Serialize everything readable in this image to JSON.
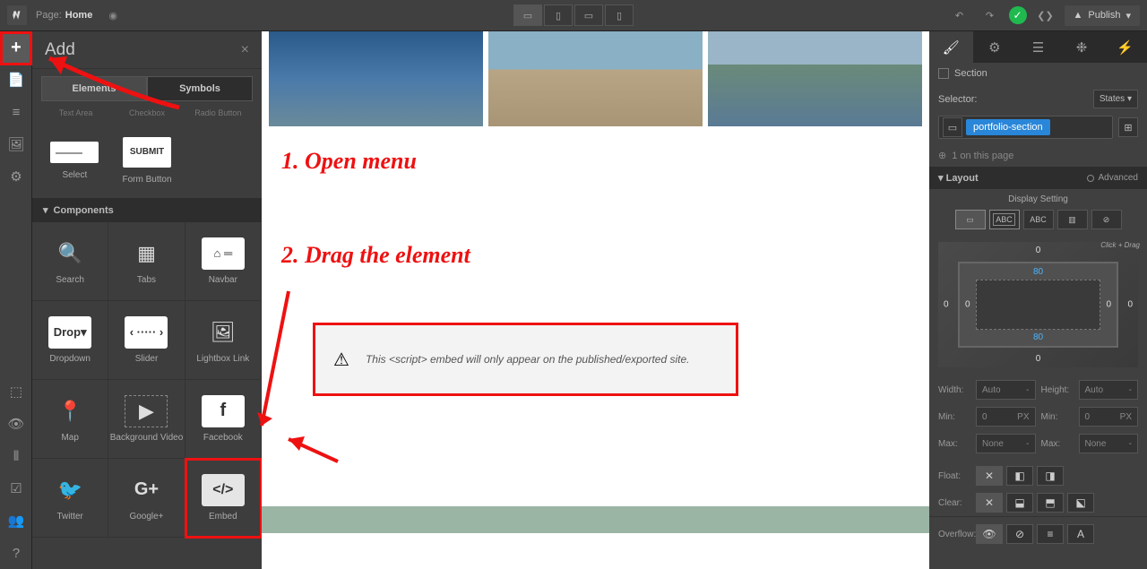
{
  "topbar": {
    "page_label": "Page:",
    "page_name": "Home",
    "publish": "Publish"
  },
  "add_panel": {
    "title": "Add",
    "tabs": {
      "elements": "Elements",
      "symbols": "Symbols"
    },
    "mini": {
      "textarea": "Text Area",
      "checkbox": "Checkbox",
      "radio": "Radio Button"
    },
    "form": {
      "select_label": "Select",
      "submit_text": "SUBMIT",
      "form_button_label": "Form Button"
    },
    "components_hdr": "Components",
    "components": {
      "search": "Search",
      "tabs": "Tabs",
      "navbar": "Navbar",
      "dropdown": "Dropdown",
      "drop_text": "Drop",
      "slider": "Slider",
      "lightbox": "Lightbox Link",
      "map": "Map",
      "bgvideo": "Background Video",
      "facebook": "Facebook",
      "twitter": "Twitter",
      "googleplus": "Google+",
      "embed": "Embed"
    }
  },
  "canvas": {
    "step1": "1. Open menu",
    "step2": "2. Drag the element",
    "embed_msg": "This <script> embed will only appear on the published/exported site."
  },
  "right_panel": {
    "section_label": "Section",
    "selector_label": "Selector:",
    "states": "States",
    "selector_value": "portfolio-section",
    "instances": "1 on this page",
    "layout_hdr": "Layout",
    "advanced": "Advanced",
    "display_setting": "Display Setting",
    "disp_abc": "ABC",
    "spacing": {
      "top": "0",
      "right": "0",
      "bottom": "0",
      "left": "0",
      "pad_top": "80",
      "pad_bottom": "80",
      "pad_left": "0",
      "pad_right": "0",
      "click_drag": "Click + Drag"
    },
    "width_label": "Width:",
    "height_label": "Height:",
    "auto": "Auto",
    "none": "None",
    "px": "PX",
    "zero": "0",
    "min_label": "Min:",
    "max_label": "Max:",
    "float_label": "Float:",
    "clear_label": "Clear:",
    "overflow_label": "Overflow:"
  }
}
